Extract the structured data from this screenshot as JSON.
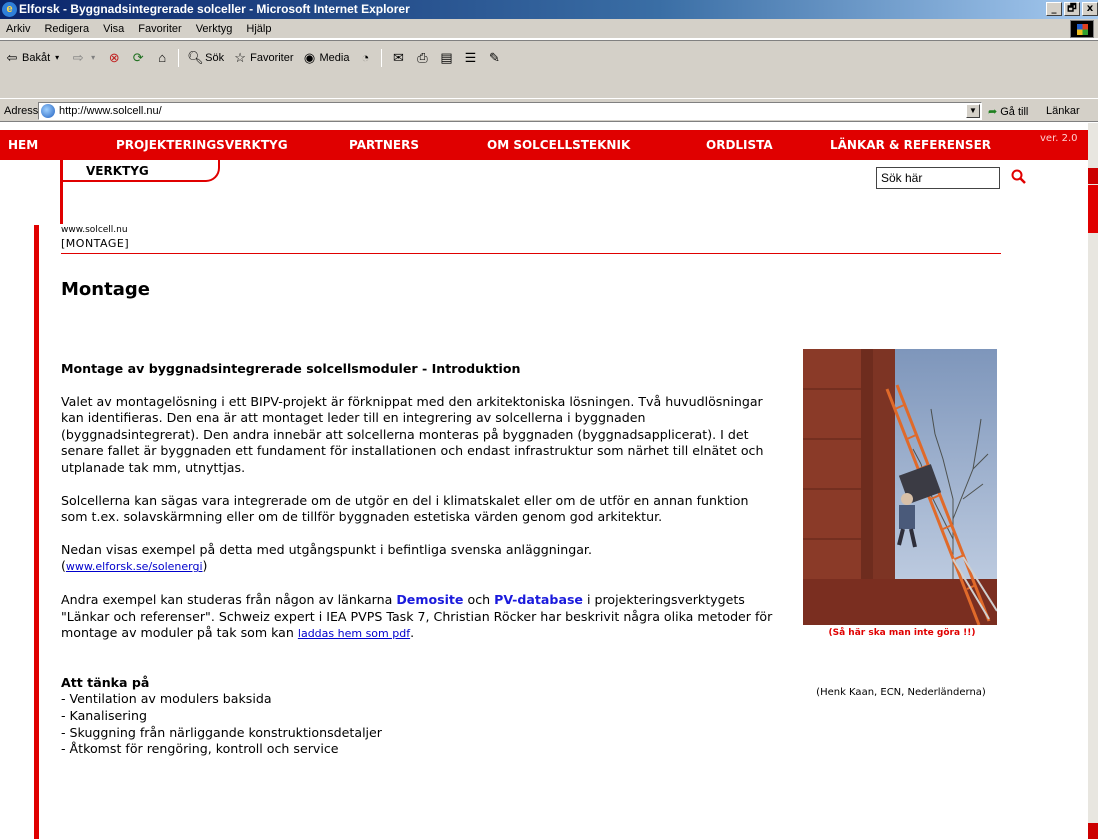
{
  "window": {
    "title": "Elforsk - Byggnadsintegrerade solceller - Microsoft Internet Explorer",
    "controls": [
      "_",
      "🗗",
      "x"
    ]
  },
  "menu": [
    "Arkiv",
    "Redigera",
    "Visa",
    "Favoriter",
    "Verktyg",
    "Hjälp"
  ],
  "toolbar": {
    "back": "Bakåt",
    "search": "Sök",
    "favorites": "Favoriter",
    "media": "Media"
  },
  "address": {
    "label": "Adress",
    "url": "http://www.solcell.nu/",
    "go": "Gå till",
    "links": "Länkar"
  },
  "site": {
    "nav": [
      "HEM",
      "PROJEKTERINGSVERKTYG",
      "PARTNERS",
      "OM SOLCELLSTEKNIK",
      "ORDLISTA",
      "LÄNKAR & REFERENSER"
    ],
    "version": "ver. 2.0",
    "subtab": "VERKTYG",
    "search_value": "Sök här",
    "crumb_site": "www.solcell.nu",
    "crumb_section": "[MONTAGE]",
    "page_title": "Montage"
  },
  "article": {
    "heading": "Montage av byggnadsintegrerade solcellsmoduler - Introduktion",
    "p1": "Valet av montagelösning i ett BIPV-projekt är förknippat med den arkitektoniska lösningen. Två huvudlösningar kan identifieras. Den ena är att montaget leder till en integrering av solcellerna i byggnaden (byggnadsintegrerat). Den andra innebär att solcellerna monteras på byggnaden (byggnadsapplicerat). I det senare fallet är byggnaden ett fundament för installationen och endast infrastruktur som närhet till elnätet och utplanade tak mm, utnyttjas.",
    "p2": "Solcellerna kan sägas vara integrerade om de utgör en del i klimatskalet eller om de utför en annan funktion som t.ex. solavskärmning eller om de tillför byggnaden estetiska värden genom god arkitektur.",
    "p3_text": "Nedan visas exempel på detta med utgångspunkt i befintliga svenska anläggningar.",
    "p3_open": "(",
    "p3_link": "www.elforsk.se/solenergi",
    "p3_close": ")",
    "p4_a": "Andra exempel kan studeras från någon av länkarna ",
    "p4_link1": "Demosite",
    "p4_b": " och ",
    "p4_link2": "PV-database",
    "p4_c": " i projekteringsverktygets \"Länkar och referenser\". Schweiz expert i IEA PVPS Task 7, Christian Röcker har beskrivit några olika metoder för montage av moduler på tak som kan ",
    "p4_link3": "laddas hem som pdf",
    "p4_d": ".",
    "think_heading": "Att tänka på",
    "think_items": [
      "- Ventilation av modulers baksida",
      "- Kanalisering",
      "- Skuggning från närliggande konstruktionsdetaljer",
      "- Åtkomst för rengöring, kontroll och service"
    ]
  },
  "figure": {
    "caption": "(Så här ska man inte göra !!)",
    "credit": "(Henk Kaan, ECN, Nederländerna)"
  },
  "colors": {
    "brand_red": "#e00000",
    "link_blue": "#0000cc"
  }
}
